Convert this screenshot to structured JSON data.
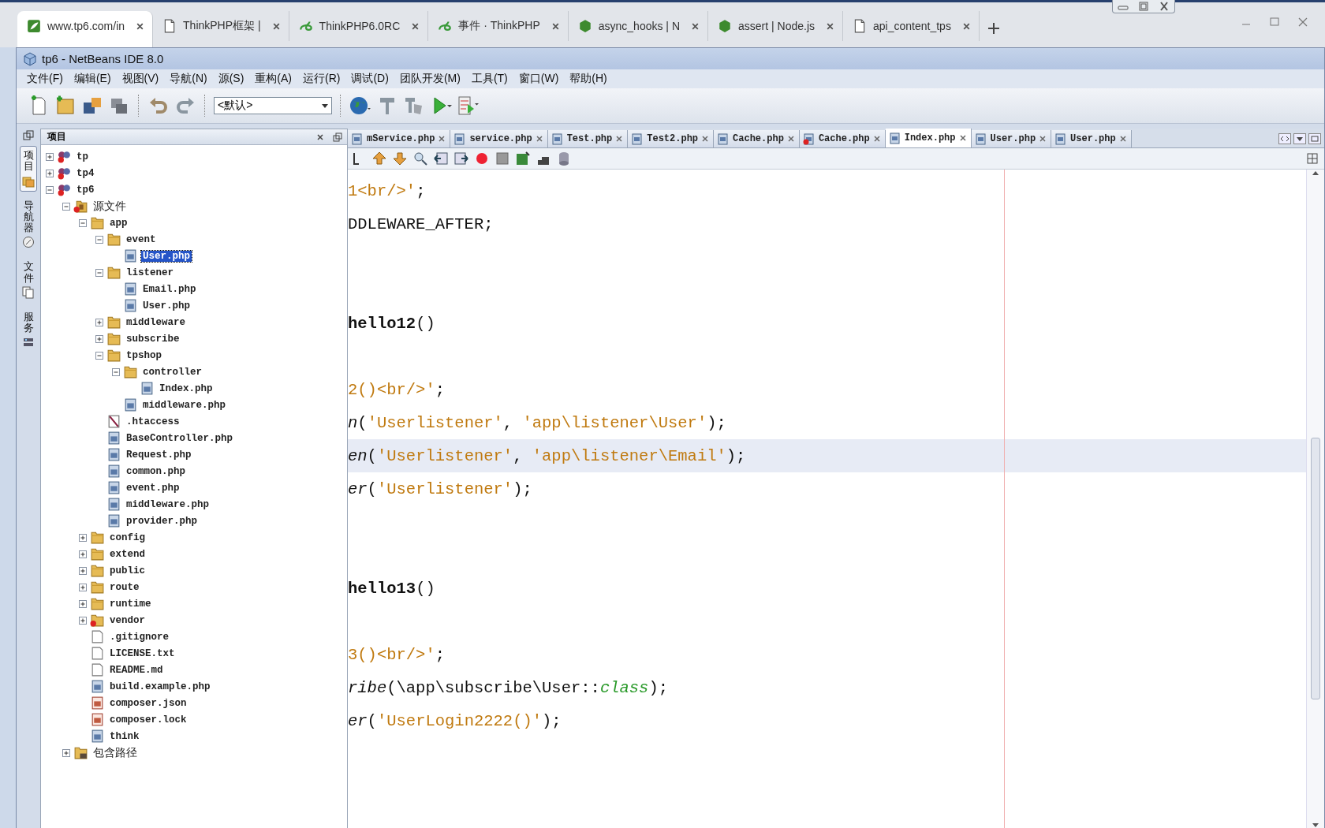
{
  "browser": {
    "tabs": [
      {
        "title": "www.tp6.com/in",
        "kind": "leaf",
        "selected": true
      },
      {
        "title": "ThinkPHP框架 |",
        "kind": "page",
        "selected": false
      },
      {
        "title": "ThinkPHP6.0RC",
        "kind": "swirl",
        "selected": false
      },
      {
        "title": "事件 · ThinkPHP",
        "kind": "swirl",
        "selected": false
      },
      {
        "title": "async_hooks | N",
        "kind": "hexagon",
        "selected": false
      },
      {
        "title": "assert | Node.js",
        "kind": "hexagon",
        "selected": false
      },
      {
        "title": "api_content_tps",
        "kind": "page",
        "selected": false
      }
    ]
  },
  "window": {
    "title": "tp6 - NetBeans IDE 8.0"
  },
  "menu": [
    "文件(F)",
    "编辑(E)",
    "视图(V)",
    "导航(N)",
    "源(S)",
    "重构(A)",
    "运行(R)",
    "调试(D)",
    "团队开发(M)",
    "工具(T)",
    "窗口(W)",
    "帮助(H)"
  ],
  "toolbar": {
    "configuration": "<默认>"
  },
  "side_tabs": [
    {
      "label": "项目",
      "selected": true
    },
    {
      "label": "导航器",
      "selected": false
    },
    {
      "label": "文件",
      "selected": false
    },
    {
      "label": "服务",
      "selected": false
    }
  ],
  "project_panel": {
    "title": "项目"
  },
  "project_tree": [
    {
      "label": "tp",
      "kind": "project",
      "expanded": false,
      "selected": false
    },
    {
      "label": "tp4",
      "kind": "project",
      "expanded": false,
      "selected": false
    },
    {
      "label": "tp6",
      "kind": "project",
      "expanded": true,
      "selected": false,
      "children": [
        {
          "label": "源文件",
          "kind": "sources",
          "expanded": true,
          "selected": false,
          "children": [
            {
              "label": "app",
              "kind": "folder",
              "expanded": true,
              "selected": false,
              "children": [
                {
                  "label": "event",
                  "kind": "folder",
                  "expanded": true,
                  "selected": false,
                  "children": [
                    {
                      "label": "User.php",
                      "kind": "php",
                      "selected": true
                    }
                  ]
                },
                {
                  "label": "listener",
                  "kind": "folder",
                  "expanded": true,
                  "selected": false,
                  "children": [
                    {
                      "label": "Email.php",
                      "kind": "php",
                      "selected": false
                    },
                    {
                      "label": "User.php",
                      "kind": "php",
                      "selected": false
                    }
                  ]
                },
                {
                  "label": "middleware",
                  "kind": "folder",
                  "expanded": false,
                  "selected": false
                },
                {
                  "label": "subscribe",
                  "kind": "folder",
                  "expanded": false,
                  "selected": false
                },
                {
                  "label": "tpshop",
                  "kind": "folder",
                  "expanded": true,
                  "selected": false,
                  "children": [
                    {
                      "label": "controller",
                      "kind": "folder",
                      "expanded": true,
                      "selected": false,
                      "children": [
                        {
                          "label": "Index.php",
                          "kind": "php",
                          "selected": false
                        }
                      ]
                    },
                    {
                      "label": "middleware.php",
                      "kind": "php",
                      "selected": false
                    }
                  ]
                },
                {
                  "label": ".htaccess",
                  "kind": "htaccess",
                  "selected": false
                },
                {
                  "label": "BaseController.php",
                  "kind": "php",
                  "selected": false
                },
                {
                  "label": "Request.php",
                  "kind": "php",
                  "selected": false
                },
                {
                  "label": "common.php",
                  "kind": "php",
                  "selected": false
                },
                {
                  "label": "event.php",
                  "kind": "php",
                  "selected": false
                },
                {
                  "label": "middleware.php",
                  "kind": "php",
                  "selected": false
                },
                {
                  "label": "provider.php",
                  "kind": "php",
                  "selected": false
                }
              ]
            },
            {
              "label": "config",
              "kind": "folder",
              "expanded": false,
              "selected": false
            },
            {
              "label": "extend",
              "kind": "folder",
              "expanded": false,
              "selected": false
            },
            {
              "label": "public",
              "kind": "folder",
              "expanded": false,
              "selected": false
            },
            {
              "label": "route",
              "kind": "folder",
              "expanded": false,
              "selected": false
            },
            {
              "label": "runtime",
              "kind": "folder",
              "expanded": false,
              "selected": false
            },
            {
              "label": "vendor",
              "kind": "error-folder",
              "expanded": false,
              "selected": false
            },
            {
              "label": ".gitignore",
              "kind": "text",
              "selected": false
            },
            {
              "label": "LICENSE.txt",
              "kind": "text",
              "selected": false
            },
            {
              "label": "README.md",
              "kind": "text",
              "selected": false
            },
            {
              "label": "build.example.php",
              "kind": "php",
              "selected": false
            },
            {
              "label": "composer.json",
              "kind": "json",
              "selected": false
            },
            {
              "label": "composer.lock",
              "kind": "json",
              "selected": false
            },
            {
              "label": "think",
              "kind": "php",
              "selected": false
            }
          ]
        },
        {
          "label": "包含路径",
          "kind": "library",
          "expanded": false,
          "selected": false
        }
      ]
    }
  ],
  "editor": {
    "tabs": [
      {
        "label": "mService.php",
        "error": false,
        "selected": false
      },
      {
        "label": "service.php",
        "error": false,
        "selected": false
      },
      {
        "label": "Test.php",
        "error": false,
        "selected": false
      },
      {
        "label": "Test2.php",
        "error": false,
        "selected": false
      },
      {
        "label": "Cache.php",
        "error": false,
        "selected": false
      },
      {
        "label": "Cache.php",
        "error": true,
        "selected": false
      },
      {
        "label": "Index.php",
        "error": false,
        "selected": true
      },
      {
        "label": "User.php",
        "error": false,
        "selected": false
      },
      {
        "label": "User.php",
        "error": false,
        "selected": false
      }
    ],
    "lines": [
      {
        "kind": "code",
        "highlighted": false,
        "segments": [
          {
            "kind": "string",
            "text": "1<br/>'"
          },
          {
            "kind": "plain",
            "text": ";"
          }
        ]
      },
      {
        "kind": "code",
        "highlighted": false,
        "segments": [
          {
            "kind": "plain",
            "text": "DDLEWARE_AFTER;"
          }
        ]
      },
      {
        "kind": "blank"
      },
      {
        "kind": "blank"
      },
      {
        "kind": "code",
        "highlighted": false,
        "segments": [
          {
            "kind": "bold",
            "text": "hello12"
          },
          {
            "kind": "plain",
            "text": "()"
          }
        ]
      },
      {
        "kind": "blank"
      },
      {
        "kind": "code",
        "highlighted": false,
        "segments": [
          {
            "kind": "string",
            "text": "2()<br/>'"
          },
          {
            "kind": "plain",
            "text": ";"
          }
        ]
      },
      {
        "kind": "code",
        "highlighted": false,
        "segments": [
          {
            "kind": "italic",
            "text": "n"
          },
          {
            "kind": "plain",
            "text": "("
          },
          {
            "kind": "string",
            "text": "'Userlistener'"
          },
          {
            "kind": "plain",
            "text": ", "
          },
          {
            "kind": "string",
            "text": "'app\\listener\\User'"
          },
          {
            "kind": "plain",
            "text": ");"
          }
        ]
      },
      {
        "kind": "code",
        "highlighted": true,
        "segments": [
          {
            "kind": "italic",
            "text": "en"
          },
          {
            "kind": "plain",
            "text": "("
          },
          {
            "kind": "string",
            "text": "'Userlistener'"
          },
          {
            "kind": "plain",
            "text": ", "
          },
          {
            "kind": "string",
            "text": "'app\\listener\\Email'"
          },
          {
            "kind": "plain",
            "text": ");"
          }
        ]
      },
      {
        "kind": "code",
        "highlighted": false,
        "segments": [
          {
            "kind": "italic",
            "text": "er"
          },
          {
            "kind": "plain",
            "text": "("
          },
          {
            "kind": "string",
            "text": "'Userlistener'"
          },
          {
            "kind": "plain",
            "text": ");"
          }
        ]
      },
      {
        "kind": "blank"
      },
      {
        "kind": "blank"
      },
      {
        "kind": "code",
        "highlighted": false,
        "segments": [
          {
            "kind": "bold",
            "text": "hello13"
          },
          {
            "kind": "plain",
            "text": "()"
          }
        ]
      },
      {
        "kind": "blank"
      },
      {
        "kind": "code",
        "highlighted": false,
        "segments": [
          {
            "kind": "string",
            "text": "3()<br/>'"
          },
          {
            "kind": "plain",
            "text": ";"
          }
        ]
      },
      {
        "kind": "code",
        "highlighted": false,
        "segments": [
          {
            "kind": "italic",
            "text": "ribe"
          },
          {
            "kind": "plain",
            "text": "(\\app\\subscribe\\User::"
          },
          {
            "kind": "constant",
            "text": "class"
          },
          {
            "kind": "plain",
            "text": ");"
          }
        ]
      },
      {
        "kind": "code",
        "highlighted": false,
        "segments": [
          {
            "kind": "italic",
            "text": "er"
          },
          {
            "kind": "plain",
            "text": "("
          },
          {
            "kind": "string",
            "text": "'UserLogin2222()'"
          },
          {
            "kind": "plain",
            "text": ");"
          }
        ]
      }
    ]
  }
}
